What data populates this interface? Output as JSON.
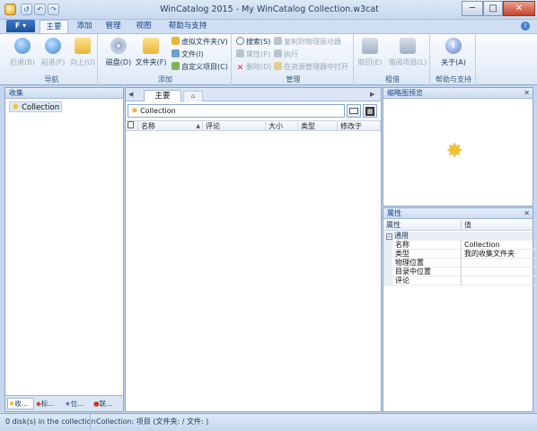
{
  "window": {
    "title": "WinCatalog 2015 - My WinCatalog Collection.w3cat",
    "minimize": "─",
    "maximize": "□",
    "close": "✕"
  },
  "quick_access": [
    "↺",
    "↶",
    "↷"
  ],
  "ribbon": {
    "file_tab": "F",
    "tabs": [
      "主要",
      "添加",
      "管理",
      "视图",
      "帮助与支持"
    ],
    "groups": {
      "nav": {
        "label": "导航",
        "back": "后退(B)",
        "forward": "前进(F)",
        "up": "向上(U)"
      },
      "add": {
        "label": "添加",
        "disk": "磁盘(D)",
        "folder": "文件夹(F)",
        "virtual_folder": "虚拟文件夹(V)",
        "file": "文件(I)",
        "custom_item": "自定义项目(C)"
      },
      "manage": {
        "label": "管理",
        "search": "搜索(S)",
        "properties": "属性(P)",
        "delete": "删除(D)",
        "copy_to_drive": "复制到物理驱动器",
        "execute": "执行",
        "open_in_explorer": "在资源管理器中打开"
      },
      "lend": {
        "label": "租借",
        "take": "取回(E)",
        "lend_item": "借阅项目(L)"
      },
      "help": {
        "label": "帮助与支持",
        "about": "关于(A)"
      }
    }
  },
  "left_pane": {
    "title": "收集",
    "tree": [
      {
        "label": "Collection"
      }
    ],
    "bottom_tabs": [
      "收...",
      "标...",
      "位...",
      "联..."
    ]
  },
  "middle_pane": {
    "tabs": [
      "主要",
      ""
    ],
    "path": "Collection",
    "columns": [
      "名称",
      "评论",
      "大小",
      "类型",
      "修改于"
    ]
  },
  "thumbnail_pane": {
    "title": "缩略图预览"
  },
  "properties_pane": {
    "title": "属性",
    "col_property": "属性",
    "col_value": "值",
    "section": "通用",
    "rows": [
      {
        "name": "名称",
        "value": "Collection"
      },
      {
        "name": "类型",
        "value": "我的收集文件夹"
      },
      {
        "name": "物理位置",
        "value": ""
      },
      {
        "name": "目录中位置",
        "value": ""
      },
      {
        "name": "评论",
        "value": ""
      }
    ]
  },
  "status": {
    "left": "0 disk(s) in the collection",
    "right": "Collection: 项目 (文件夹: / 文件: )"
  },
  "colors": {
    "accent": "#1c4f9c",
    "chrome": "#c5d7ee",
    "star": "#f2c230"
  }
}
